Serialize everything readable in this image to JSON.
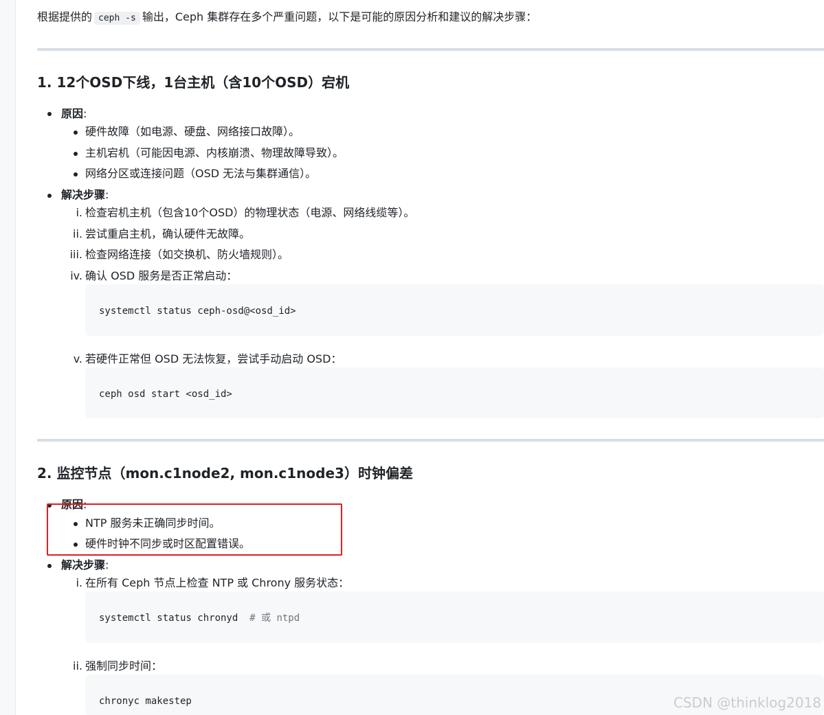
{
  "intro": {
    "before": "根据提供的",
    "code": "ceph -s",
    "after": "输出，Ceph 集群存在多个严重问题，以下是可能的原因分析和建议的解决步骤："
  },
  "section1": {
    "title": "1. 12个OSD下线，1台主机（含10个OSD）宕机",
    "cause_label": "原因",
    "cause_colon": ":",
    "causes": [
      "硬件故障（如电源、硬盘、网络接口故障）。",
      "主机宕机（可能因电源、内核崩溃、物理故障导致）。",
      "网络分区或连接问题（OSD 无法与集群通信）。"
    ],
    "steps_label": "解决步骤",
    "steps_colon": ":",
    "steps": [
      {
        "num": "i.",
        "text": "检查宕机主机（包含10个OSD）的物理状态（电源、网络线缆等）。"
      },
      {
        "num": "ii.",
        "text": "尝试重启主机，确认硬件无故障。"
      },
      {
        "num": "iii.",
        "text": "检查网络连接（如交换机、防火墙规则）。"
      },
      {
        "num": "iv.",
        "text": "确认 OSD 服务是否正常启动：",
        "code": "systemctl status ceph-osd@<osd_id>"
      },
      {
        "num": "v.",
        "text": "若硬件正常但 OSD 无法恢复，尝试手动启动 OSD：",
        "code": "ceph osd start <osd_id>"
      }
    ]
  },
  "section2": {
    "title": "2. 监控节点（mon.c1node2, mon.c1node3）时钟偏差",
    "cause_label": "原因",
    "cause_colon": ":",
    "causes": [
      "NTP 服务未正确同步时间。",
      "硬件时钟不同步或时区配置错误。"
    ],
    "steps_label": "解决步骤",
    "steps_colon": ":",
    "steps": [
      {
        "num": "i.",
        "text": "在所有 Ceph 节点上检查 NTP 或 Chrony 服务状态：",
        "code": "systemctl status chronyd",
        "comment": "# 或 ntpd"
      },
      {
        "num": "ii.",
        "text": "强制同步时间：",
        "code": "chronyc makestep"
      }
    ]
  },
  "watermark": "CSDN @thinklog2018",
  "colors": {
    "highlight_box": "#e11d1d",
    "code_bg": "#f6f8fa",
    "rule": "#d8dee4"
  }
}
